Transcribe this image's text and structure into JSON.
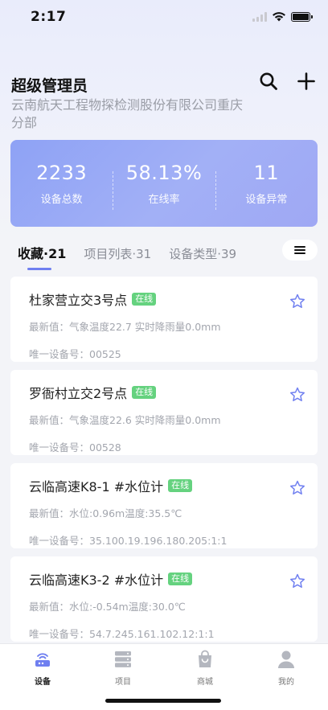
{
  "status_bar": {
    "time": "2:17"
  },
  "header": {
    "title": "超级管理员",
    "organization": "云南航天工程物探检测股份有限公司重庆分部"
  },
  "stats": [
    {
      "value": "2233",
      "label": "设备总数"
    },
    {
      "value": "58.13%",
      "label": "在线率"
    },
    {
      "value": "11",
      "label": "设备异常"
    }
  ],
  "tabs": [
    {
      "label": "收藏·21",
      "active": true
    },
    {
      "label": "项目列表·31",
      "active": false
    },
    {
      "label": "设备类型·39",
      "active": false
    }
  ],
  "devices": [
    {
      "name": "杜家营立交3号点",
      "status": "在线",
      "latest": "最新值：气象温度22.7 实时降雨量0.0mm",
      "device_id": "唯一设备号：00525"
    },
    {
      "name": "罗衙村立交2号点",
      "status": "在线",
      "latest": "最新值：气象温度22.6 实时降雨量0.0mm",
      "device_id": "唯一设备号：00528"
    },
    {
      "name": "云临高速K8-1 #水位计",
      "status": "在线",
      "latest": "最新值：水位:0.96m温度:35.5℃",
      "device_id": "唯一设备号：35.100.19.196.180.205:1:1"
    },
    {
      "name": "云临高速K3-2 #水位计",
      "status": "在线",
      "latest": "最新值：水位:-0.54m温度:30.0℃",
      "device_id": "唯一设备号：54.7.245.161.102.12:1:1"
    }
  ],
  "bottom_nav": [
    {
      "label": "设备",
      "icon": "device-router-icon",
      "active": true
    },
    {
      "label": "项目",
      "icon": "server-stack-icon",
      "active": false
    },
    {
      "label": "商城",
      "icon": "shopping-bag-icon",
      "active": false
    },
    {
      "label": "我的",
      "icon": "user-icon",
      "active": false
    }
  ],
  "colors": {
    "accent": "#6f7ff0",
    "online_tag": "#65d27f",
    "stats_card": "#97a6f5"
  }
}
